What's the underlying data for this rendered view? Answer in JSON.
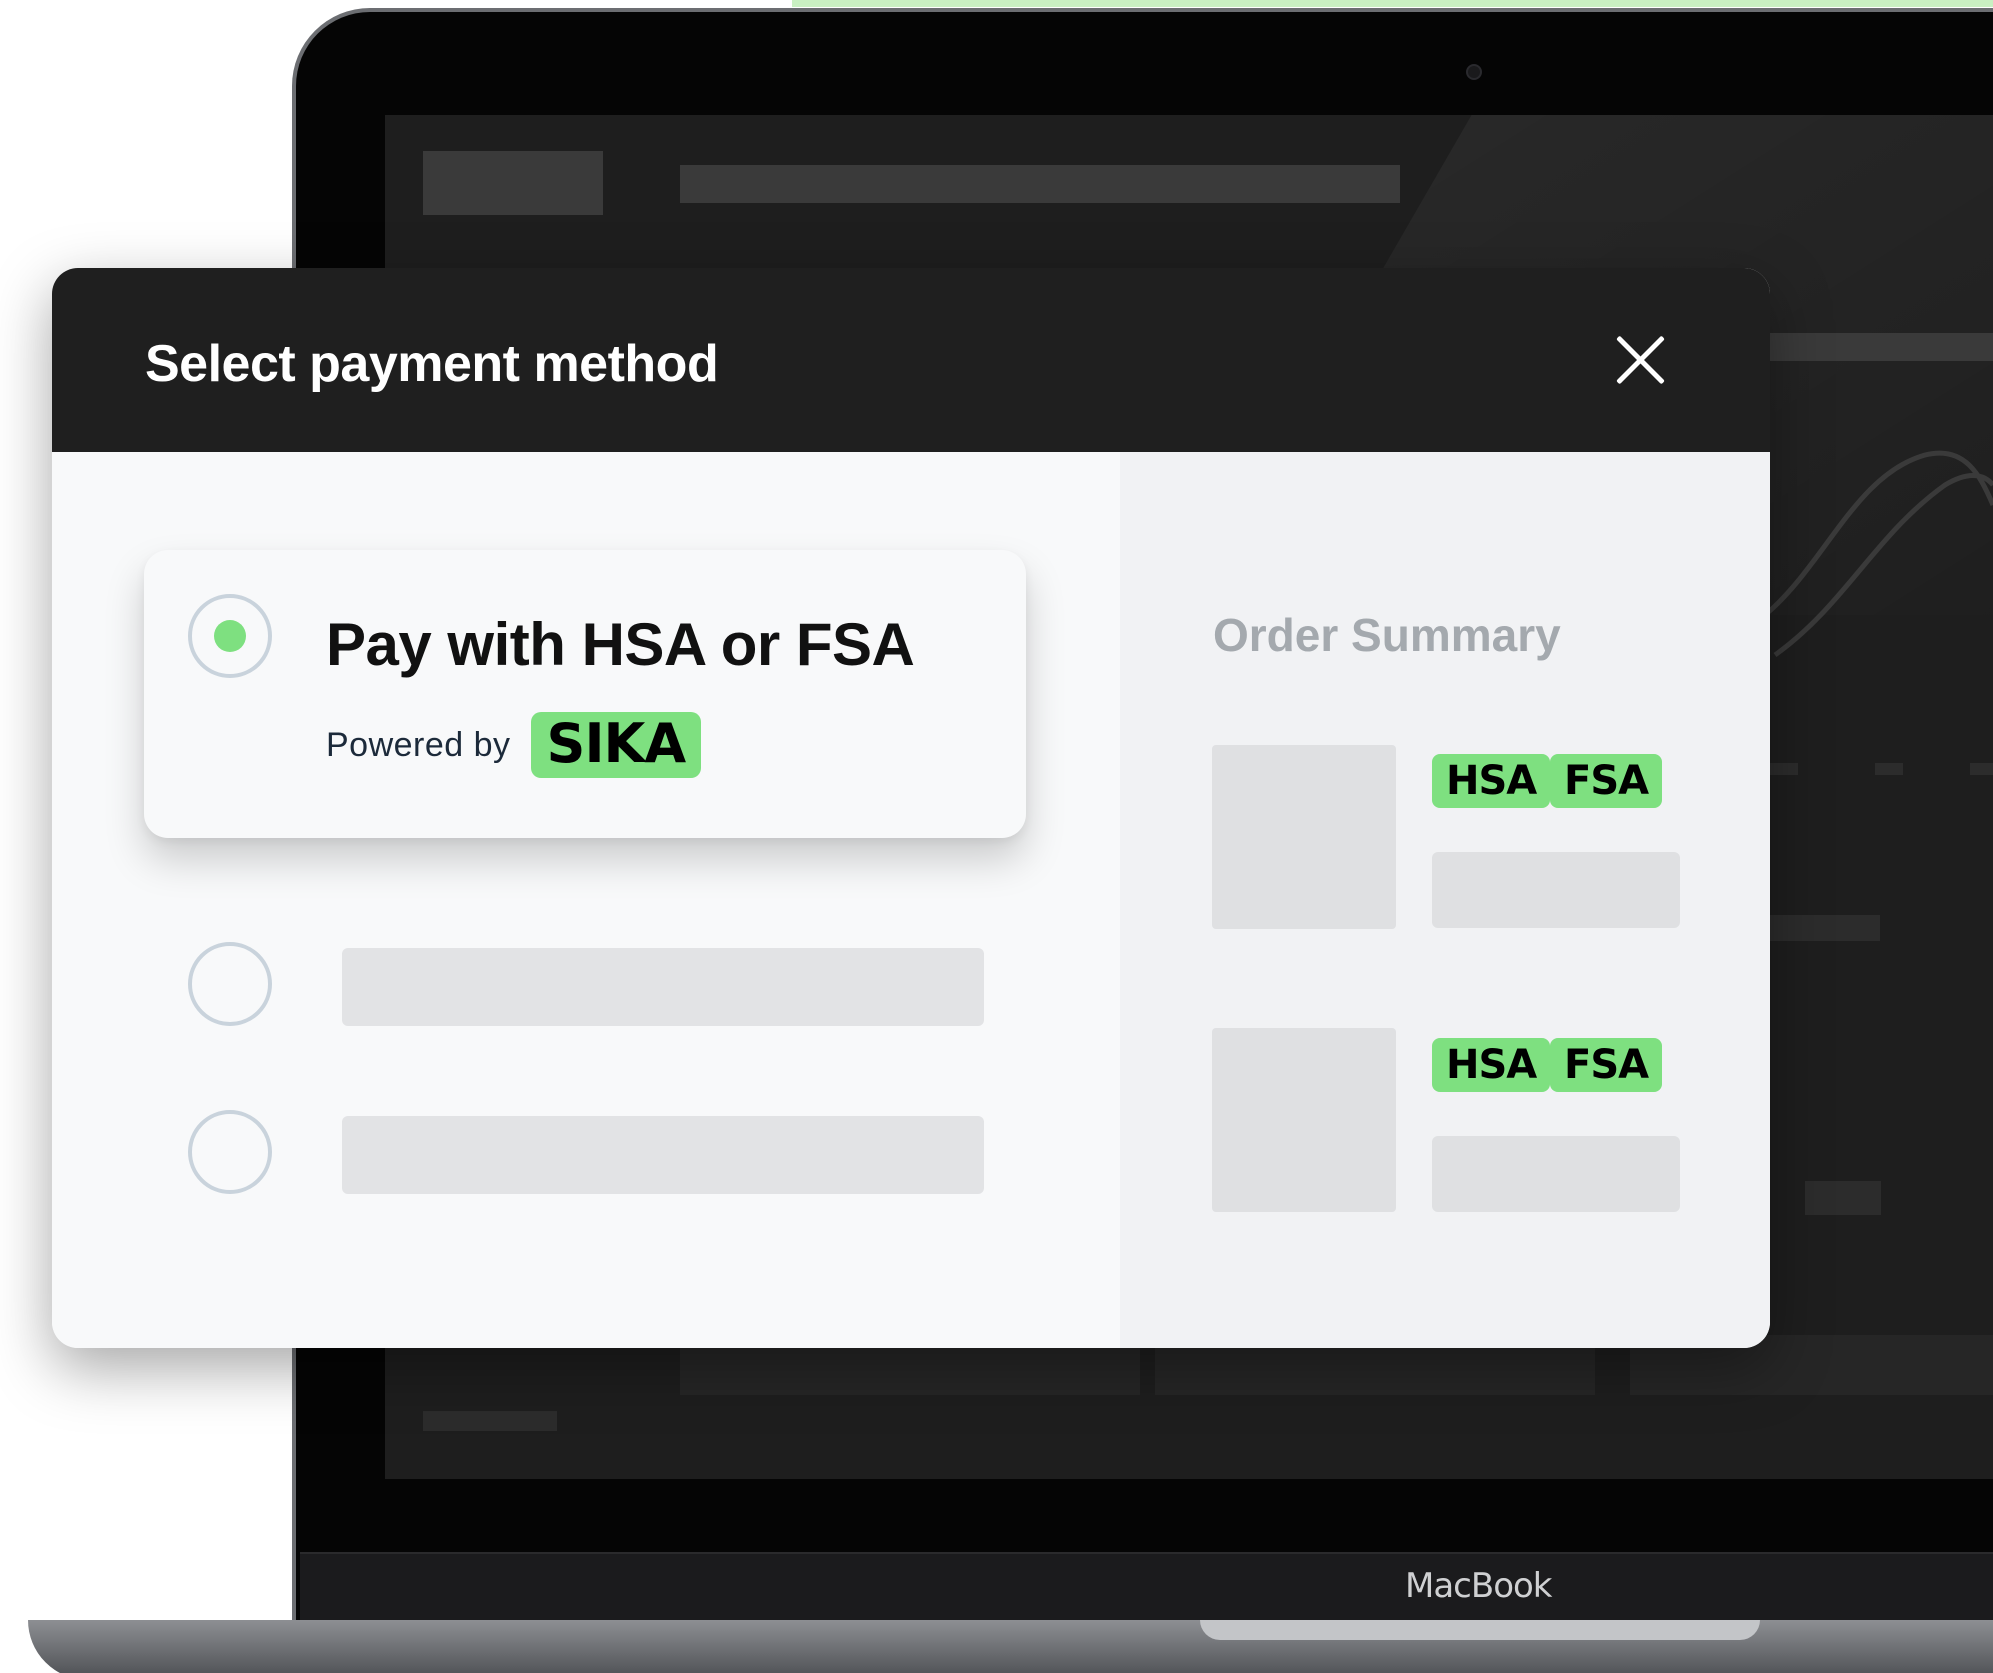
{
  "device": {
    "brand_label": "MacBook"
  },
  "modal": {
    "title": "Select payment method",
    "close_icon": "close-icon"
  },
  "payment_options": [
    {
      "title": "Pay with HSA or FSA",
      "powered_by_label": "Powered by",
      "provider_badge": "SIKA",
      "selected": true
    },
    {
      "title": "",
      "selected": false
    },
    {
      "title": "",
      "selected": false
    }
  ],
  "order_summary": {
    "title": "Order Summary",
    "items": [
      {
        "tags": [
          "HSA",
          "FSA"
        ]
      },
      {
        "tags": [
          "HSA",
          "FSA"
        ]
      }
    ]
  },
  "colors": {
    "accent_green": "#7ee080",
    "header_dark": "#1f1f1f",
    "placeholder_gray": "#e2e3e5"
  }
}
